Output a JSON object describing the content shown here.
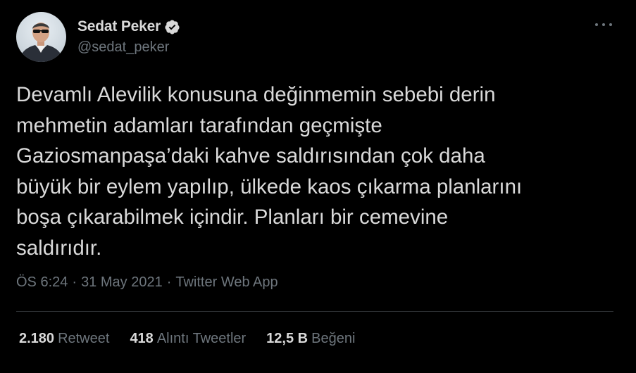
{
  "author": {
    "display_name": "Sedat Peker",
    "handle": "@sedat_peker",
    "verified": true
  },
  "tweet": {
    "text": "Devamlı Alevilik konusuna değinmemin sebebi derin\nmehmetin adamları tarafından geçmişte\nGaziosmanpaşa’daki kahve saldırısından çok daha\nbüyük bir eylem yapılıp, ülkede kaos çıkarma planlarını\nboşa çıkarabilmek içindir. Planları bir cemevine\nsaldırıdır.",
    "time": "ÖS 6:24",
    "separator": "·",
    "date": "31 May 2021",
    "source": "Twitter Web App"
  },
  "stats": {
    "retweets": {
      "count": "2.180",
      "label": "Retweet"
    },
    "quotes": {
      "count": "418",
      "label": "Alıntı Tweetler"
    },
    "likes": {
      "count": "12,5 B",
      "label": "Beğeni"
    }
  },
  "icons": {
    "verified": "verified-badge-icon",
    "more": "more-options-icon"
  },
  "colors": {
    "background": "#000000",
    "text_primary": "#d9d9d9",
    "text_secondary": "#6e767d",
    "divider": "#2f3336"
  }
}
